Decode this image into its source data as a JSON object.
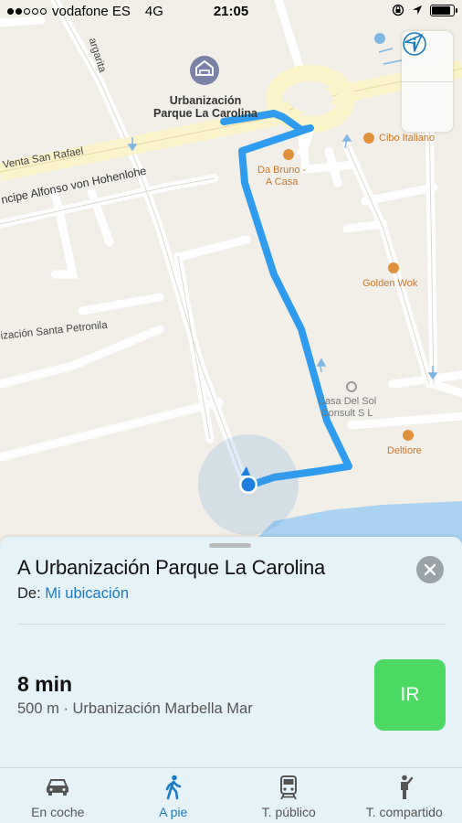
{
  "status_bar": {
    "carrier": "vodafone ES",
    "network": "4G",
    "time": "21:05",
    "signal_bars_filled": 2,
    "signal_bars_total": 5,
    "battery_level": 0.9
  },
  "map": {
    "destination_label": "Urbanización Parque La Carolina",
    "streets": {
      "venta_san_rafael": "Venta San Rafael",
      "alfonso": "ncipe Alfonso von Hohenlohe",
      "margarita": "argarita",
      "santa_petronila": "ización Santa Petronila"
    },
    "pois": {
      "cibo_italiano": "Cibo Italiano",
      "da_bruno": "Da Bruno -\nA Casa",
      "golden_wok": "Golden Wok",
      "casa_del_sol": "Casa Del Sol\nConsult S L",
      "deltiore": "Deltiore"
    },
    "controls": {
      "info_icon": "info-icon",
      "location_icon": "location-arrow-icon"
    }
  },
  "card": {
    "title": "A Urbanización Parque La Carolina",
    "from_label": "De:",
    "from_value": "Mi ubicación",
    "duration": "8 min",
    "route_detail": "500 m · Urbanización Marbella Mar",
    "go_label": "IR"
  },
  "tabs": [
    {
      "label": "En coche",
      "icon": "car-icon",
      "active": false
    },
    {
      "label": "A pie",
      "icon": "walk-icon",
      "active": true
    },
    {
      "label": "T. público",
      "icon": "train-icon",
      "active": false
    },
    {
      "label": "T. compartido",
      "icon": "rideshare-icon",
      "active": false
    }
  ],
  "colors": {
    "route": "#2f9cf0",
    "accent": "#1a7ac6",
    "go_button": "#4cd964",
    "poi": "#e0913b",
    "water": "#a9d3f0"
  }
}
